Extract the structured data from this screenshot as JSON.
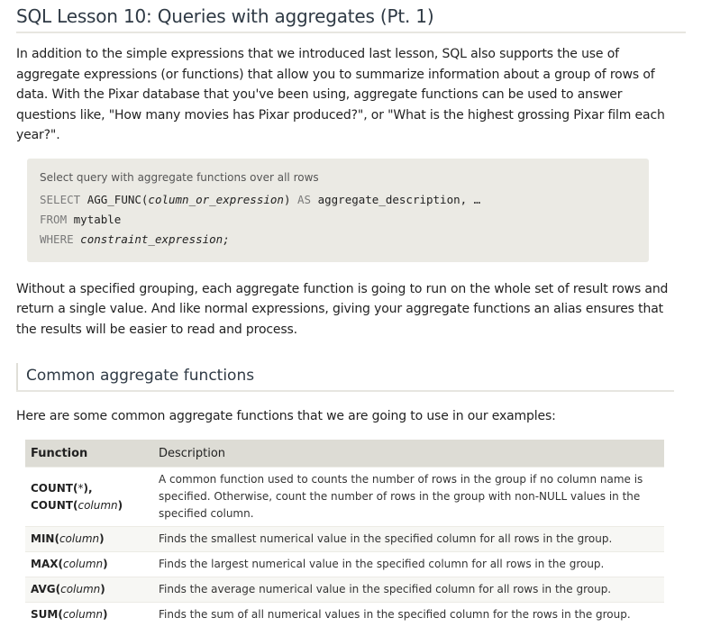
{
  "lesson": {
    "title": "SQL Lesson 10: Queries with aggregates (Pt. 1)",
    "intro": "In addition to the simple expressions that we introduced last lesson, SQL also supports the use of aggregate expressions (or functions) that allow you to summarize information about a group of rows of data. With the Pixar database that you've been using, aggregate functions can be used to answer questions like, \"How many movies has Pixar produced?\", or \"What is the highest grossing Pixar film each year?\".",
    "code_caption": "Select query with aggregate functions over all rows",
    "code": {
      "line1_kw": "SELECT",
      "line1_func": "AGG_FUNC(",
      "line1_arg": "column_or_expression",
      "line1_close": ")",
      "line1_as": "AS",
      "line1_alias": "aggregate_description, …",
      "line2_kw": "FROM",
      "line2_table": "mytable",
      "line3_kw": "WHERE",
      "line3_expr": "constraint_expression;"
    },
    "paragraph2": "Without a specified grouping, each aggregate function is going to run on the whole set of result rows and return a single value. And like normal expressions, giving your aggregate functions an alias ensures that the results will be easier to read and process.",
    "section_title": "Common aggregate functions",
    "paragraph3": "Here are some common aggregate functions that we are going to use in our examples:"
  },
  "table": {
    "headers": [
      "Function",
      "Description"
    ],
    "rows": [
      {
        "name1": "COUNT(",
        "p1": "*",
        "c1": "),",
        "name2": "COUNT(",
        "p2": "column",
        "c2": ")",
        "desc": "A common function used to counts the number of rows in the group if no column name is specified. Otherwise, count the number of rows in the group with non-NULL values in the specified column."
      },
      {
        "name1": "MIN(",
        "p1": "column",
        "c1": ")",
        "desc": "Finds the smallest numerical value in the specified column for all rows in the group."
      },
      {
        "name1": "MAX(",
        "p1": "column",
        "c1": ")",
        "desc": "Finds the largest numerical value in the specified column for all rows in the group."
      },
      {
        "name1": "AVG(",
        "p1": "column",
        "c1": ")",
        "desc": "Finds the average numerical value in the specified column for all rows in the group."
      },
      {
        "name1": "SUM(",
        "p1": "column",
        "c1": ")",
        "desc": "Finds the sum of all numerical values in the specified column for the rows in the group."
      }
    ]
  }
}
